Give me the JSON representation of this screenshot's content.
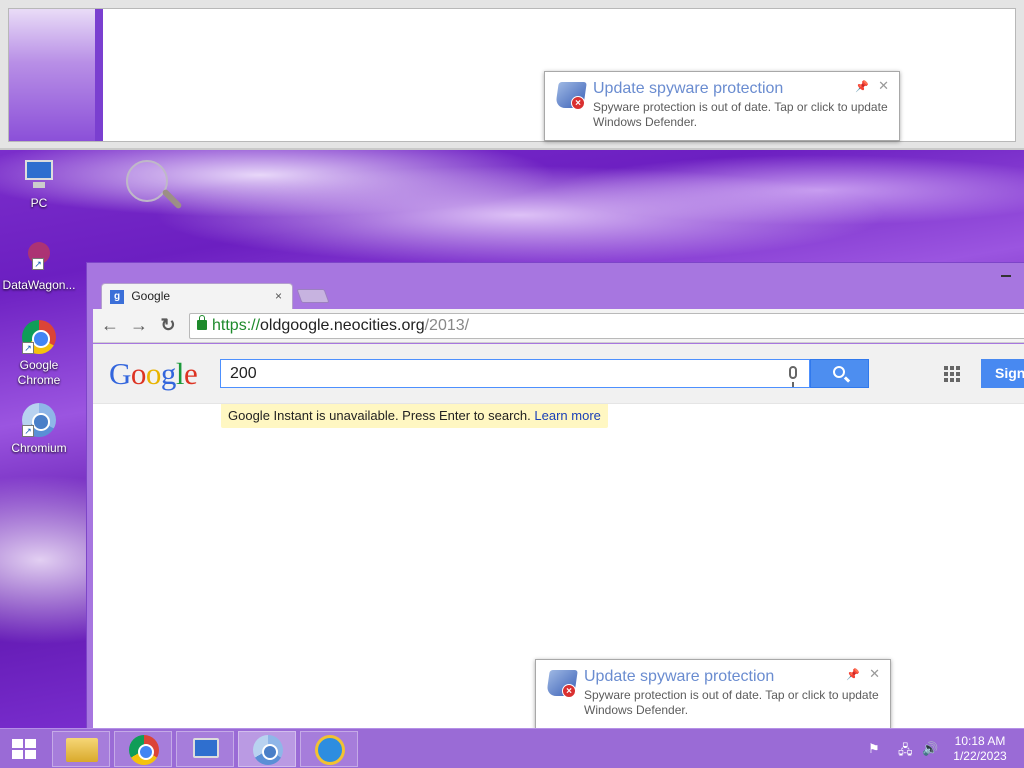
{
  "desktop": {
    "icons": [
      {
        "label": "PC"
      },
      {
        "label": "DataWagon..."
      },
      {
        "label": "Google Chrome"
      },
      {
        "label": "Chromium"
      }
    ]
  },
  "browser": {
    "tab_title": "Google",
    "tab_favicon": "g",
    "tab_close": "×",
    "url_scheme": "https://",
    "url_host": "oldgoogle.neocities.org",
    "url_path": "/2013/",
    "back": "←",
    "forward": "→",
    "reload": "↻"
  },
  "google": {
    "logo_letters": [
      "G",
      "o",
      "o",
      "g",
      "l",
      "e"
    ],
    "search_value": "200",
    "signin_label": "Sign",
    "instant_text": "Google Instant is unavailable. Press Enter to search.",
    "instant_link": "Learn more"
  },
  "notification": {
    "title": "Update spyware protection",
    "text": "Spyware protection is out of date. Tap or click to update Windows Defender.",
    "badge": "×",
    "pin": "📌",
    "close": "✕"
  },
  "tray": {
    "flag": "⚑",
    "network": "🖧",
    "volume": "🔊"
  },
  "clock": {
    "time": "10:18 AM",
    "date": "1/22/2023"
  },
  "colors": {
    "accent_purple": "#9a6bd6",
    "search_blue": "#4d8ef0",
    "notification_title": "#6a8cd0"
  },
  "icons": [
    "pc-icon",
    "datawagon-icon",
    "chrome-icon",
    "chromium-icon",
    "windows-start-icon",
    "file-explorer-icon",
    "ie-icon",
    "shield-icon",
    "mic-icon",
    "search-icon",
    "apps-grid-icon",
    "lock-icon"
  ]
}
